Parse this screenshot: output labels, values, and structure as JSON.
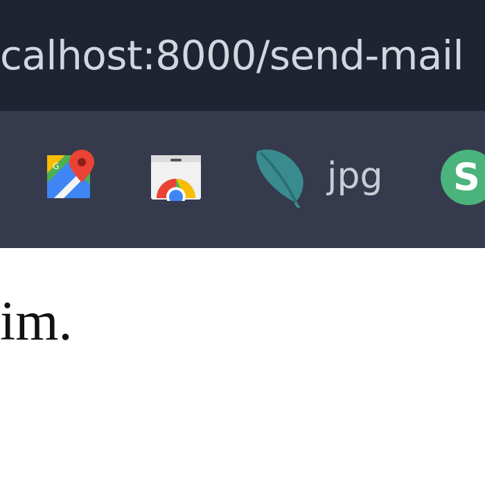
{
  "address_bar": {
    "url": "calhost:8000/send-mail"
  },
  "bookmarks": [
    {
      "icon": "google-maps-icon"
    },
    {
      "icon": "chrome-web-store-icon"
    },
    {
      "icon": "feather-icon",
      "label": "jpg"
    },
    {
      "icon": "s-circle-icon",
      "letter": "S"
    }
  ],
  "page": {
    "text": "im."
  }
}
